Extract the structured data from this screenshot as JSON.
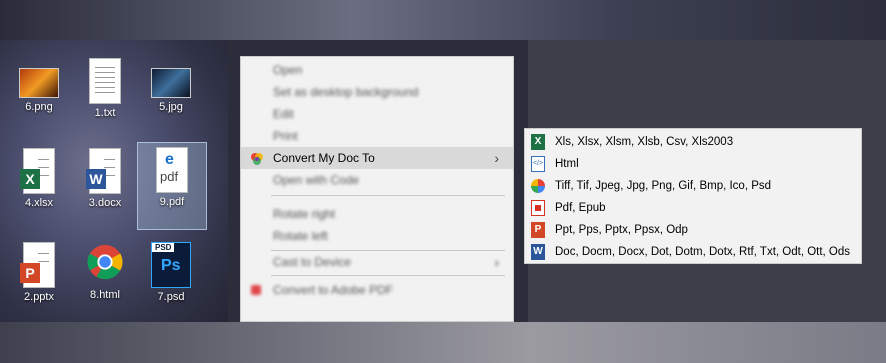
{
  "desktop": {
    "icons": [
      {
        "label": "6.png",
        "icon": "png-image-icon"
      },
      {
        "label": "1.txt",
        "icon": "text-file-icon"
      },
      {
        "label": "5.jpg",
        "icon": "jpg-image-icon"
      },
      {
        "label": "4.xlsx",
        "icon": "excel-file-icon"
      },
      {
        "label": "3.docx",
        "icon": "word-file-icon"
      },
      {
        "label": "9.pdf",
        "icon": "edge-pdf-icon",
        "pdf_text": "pdf"
      },
      {
        "label": "2.pptx",
        "icon": "powerpoint-file-icon"
      },
      {
        "label": "8.html",
        "icon": "chrome-icon"
      },
      {
        "label": "7.psd",
        "icon": "photoshop-file-icon",
        "psd_tag": "PSD",
        "ps_text": "Ps"
      }
    ]
  },
  "context_menu": {
    "items": [
      {
        "label": "Open",
        "blurred": true
      },
      {
        "label": "Set as desktop background",
        "blurred": true
      },
      {
        "label": "Edit",
        "blurred": true
      },
      {
        "label": "Print",
        "blurred": true
      },
      {
        "label": "Convert My Doc To",
        "blurred": false,
        "highlighted": true
      },
      {
        "label": "Open with Code",
        "blurred": true
      },
      {
        "label": "Rotate right",
        "blurred": true
      },
      {
        "label": "Rotate left",
        "blurred": true
      },
      {
        "label": "Cast to Device",
        "blurred": true
      },
      {
        "label": "Convert to Adobe PDF",
        "blurred": true
      }
    ],
    "arrow": "›"
  },
  "submenu": {
    "items": [
      {
        "label": "Xls, Xlsx, Xlsm, Xlsb, Csv, Xls2003",
        "icon": "excel-icon",
        "color": "#1e7145"
      },
      {
        "label": "Html",
        "icon": "html-icon",
        "color": "#3a6fb5"
      },
      {
        "label": "Tiff, Tif, Jpeg, Jpg, Png, Gif, Bmp, Ico, Psd",
        "icon": "photos-pinwheel-icon",
        "color": "#e94235"
      },
      {
        "label": "Pdf, Epub",
        "icon": "pdf-icon",
        "color": "#d93025"
      },
      {
        "label": "Ppt, Pps, Pptx, Ppsx, Odp",
        "icon": "powerpoint-icon",
        "color": "#d24726"
      },
      {
        "label": "Doc, Docm, Docx, Dot, Dotm, Dotx, Rtf, Txt, Odt, Ott, Ods",
        "icon": "word-icon",
        "color": "#2b579a"
      }
    ]
  }
}
